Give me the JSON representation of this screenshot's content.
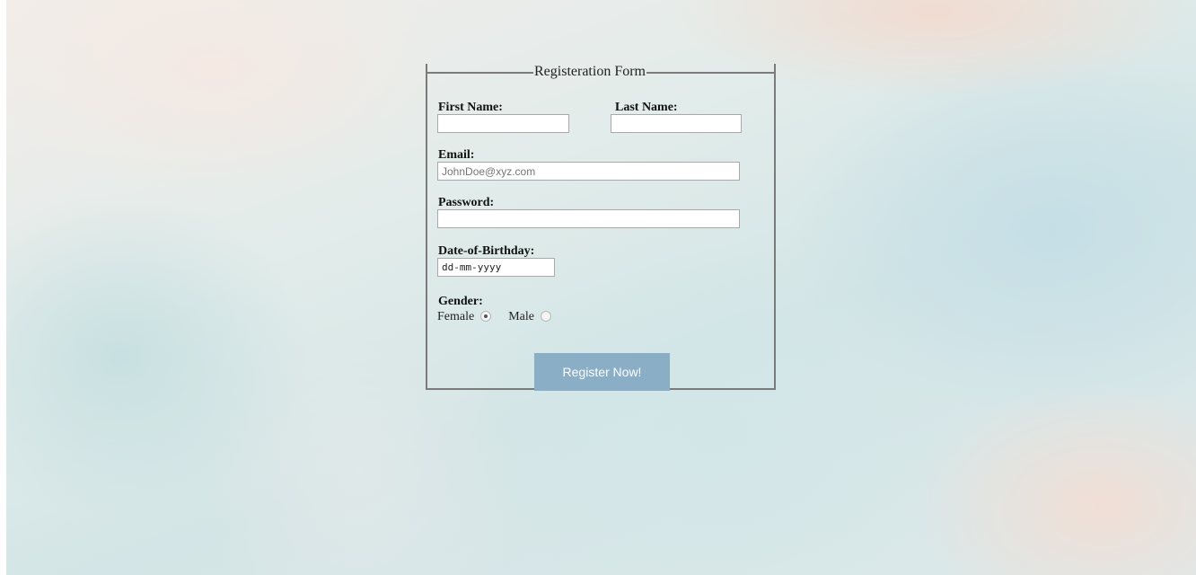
{
  "form": {
    "legend": "Registeration Form",
    "first_name_label": "First Name:",
    "last_name_label": "Last Name:",
    "first_name_value": "",
    "last_name_value": "",
    "email_label": "Email:",
    "email_placeholder": "JohnDoe@xyz.com",
    "password_label": "Password:",
    "password_value": "",
    "dob_label": "Date-of-Birthday:",
    "dob_placeholder": "dd-mm-yyyy",
    "gender_label": "Gender:",
    "gender_options": [
      {
        "label": "Female",
        "checked": true
      },
      {
        "label": "Male",
        "checked": false
      }
    ],
    "submit_label": "Register Now!"
  },
  "colors": {
    "button_bg": "#8aaec6",
    "border": "#7b7b7b"
  }
}
